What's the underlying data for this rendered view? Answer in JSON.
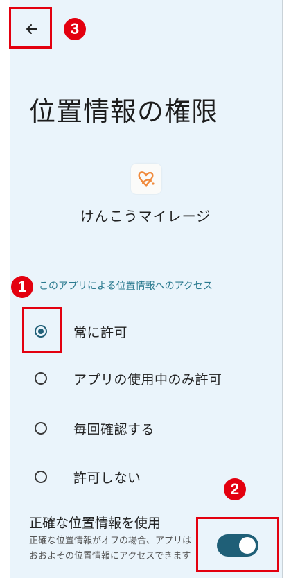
{
  "header": {
    "back_icon": "arrow-left-icon",
    "title": "位置情報の権限"
  },
  "app": {
    "name": "けんこうマイレージ",
    "icon": "app-logo-icon",
    "icon_color": "#f08a3c"
  },
  "access": {
    "section_label": "このアプリによる位置情報へのアクセス",
    "options": [
      {
        "label": "常に許可",
        "selected": true
      },
      {
        "label": "アプリの使用中のみ許可",
        "selected": false
      },
      {
        "label": "毎回確認する",
        "selected": false
      },
      {
        "label": "許可しない",
        "selected": false
      }
    ]
  },
  "precise": {
    "title": "正確な位置情報を使用",
    "description": "正確な位置情報がオフの場合、アプリはおおよその位置情報にアクセスできます",
    "enabled": true
  },
  "annotations": {
    "badge_1": "1",
    "badge_2": "2",
    "badge_3": "3",
    "color": "#e3000f"
  },
  "colors": {
    "accent": "#1f5f77",
    "background": "#eaf4fb",
    "section_label": "#2b7a8f"
  }
}
